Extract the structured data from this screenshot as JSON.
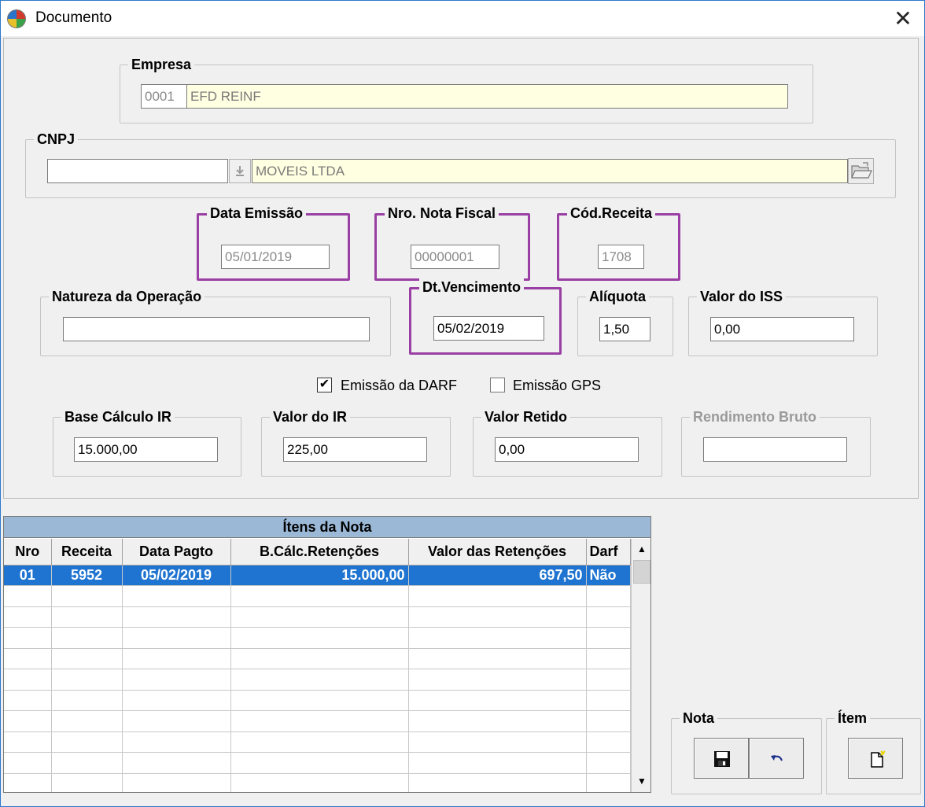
{
  "window": {
    "title": "Documento",
    "close_glyph": "✕"
  },
  "empresa": {
    "legend": "Empresa",
    "code": "0001",
    "name": "EFD REINF"
  },
  "cnpj": {
    "legend": "CNPJ",
    "value": "",
    "name": "MOVEIS LTDA",
    "lookup_icon": "download-arrow-icon",
    "open_icon": "folder-open-icon"
  },
  "data_emissao": {
    "legend": "Data Emissão",
    "value": "05/01/2019"
  },
  "nro_nota": {
    "legend": "Nro. Nota Fiscal",
    "value": "00000001"
  },
  "cod_receita": {
    "legend": "Cód.Receita",
    "value": "1708"
  },
  "natureza": {
    "legend": "Natureza da Operação",
    "value": ""
  },
  "dt_vencimento": {
    "legend": "Dt.Vencimento",
    "value": "05/02/2019"
  },
  "aliquota": {
    "legend": "Alíquota",
    "value": "1,50"
  },
  "valor_iss": {
    "legend": "Valor do ISS",
    "value": "0,00"
  },
  "emissao_darf": {
    "label": "Emissão da DARF",
    "checked": true,
    "mark": "✔"
  },
  "emissao_gps": {
    "label": "Emissão GPS",
    "checked": false
  },
  "base_ir": {
    "legend": "Base Cálculo IR",
    "value": "15.000,00"
  },
  "valor_ir": {
    "legend": "Valor do IR",
    "value": "225,00"
  },
  "valor_retido": {
    "legend": "Valor Retido",
    "value": "0,00"
  },
  "rendimento_bruto": {
    "legend": "Rendimento Bruto",
    "value": ""
  },
  "items_grid": {
    "caption": "Ítens da Nota",
    "columns": [
      "Nro",
      "Receita",
      "Data Pagto",
      "B.Cálc.Retenções",
      "Valor das Retenções",
      "Darf"
    ],
    "rows": [
      {
        "nro": "01",
        "receita": "5952",
        "data_pagto": "05/02/2019",
        "base": "15.000,00",
        "valor": "697,50",
        "darf": "Não"
      }
    ],
    "scroll_up": "▲",
    "scroll_down": "▼"
  },
  "nota_group": {
    "legend": "Nota",
    "save_icon": "floppy-disk-icon",
    "undo_icon": "undo-arrow-icon"
  },
  "item_group": {
    "legend": "Ítem",
    "new_icon": "new-document-icon"
  },
  "colors": {
    "highlight": "#9a3fa3",
    "selection": "#1e74d0",
    "caption": "#9bb9d7",
    "readonly_bg": "#ffffe1"
  }
}
